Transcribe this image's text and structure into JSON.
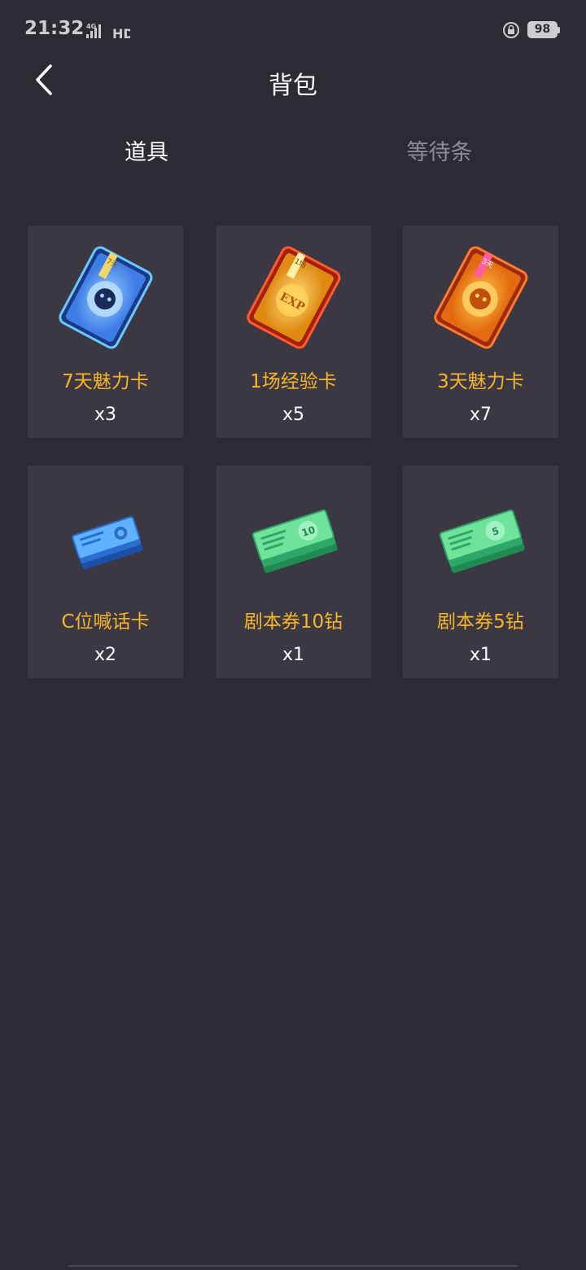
{
  "status_bar": {
    "time": "21:32",
    "network": "4G",
    "hd": "HD",
    "battery": "98"
  },
  "header": {
    "title": "背包"
  },
  "tabs": [
    {
      "label": "道具",
      "active": true
    },
    {
      "label": "等待条",
      "active": false
    }
  ],
  "items": [
    {
      "name": "7天魅力卡",
      "qty": "x3",
      "icon": "blue-charm-card-icon",
      "badge": "7天"
    },
    {
      "name": "1场经验卡",
      "qty": "x5",
      "icon": "gold-exp-card-icon",
      "badge": "1场",
      "emblem": "EXP"
    },
    {
      "name": "3天魅力卡",
      "qty": "x7",
      "icon": "orange-charm-card-icon",
      "badge": "3天"
    },
    {
      "name": "C位喊话卡",
      "qty": "x2",
      "icon": "blue-ticket-stack-icon"
    },
    {
      "name": "剧本券10钻",
      "qty": "x1",
      "icon": "green-cash-stack-icon",
      "face_value": "10"
    },
    {
      "name": "剧本券5钻",
      "qty": "x1",
      "icon": "green-cash-stack-icon",
      "face_value": "5"
    }
  ],
  "colors": {
    "background": "#2d2a34",
    "card": "#3b3843",
    "item_name": "#f6b628",
    "tab_inactive": "#8e8b95"
  }
}
